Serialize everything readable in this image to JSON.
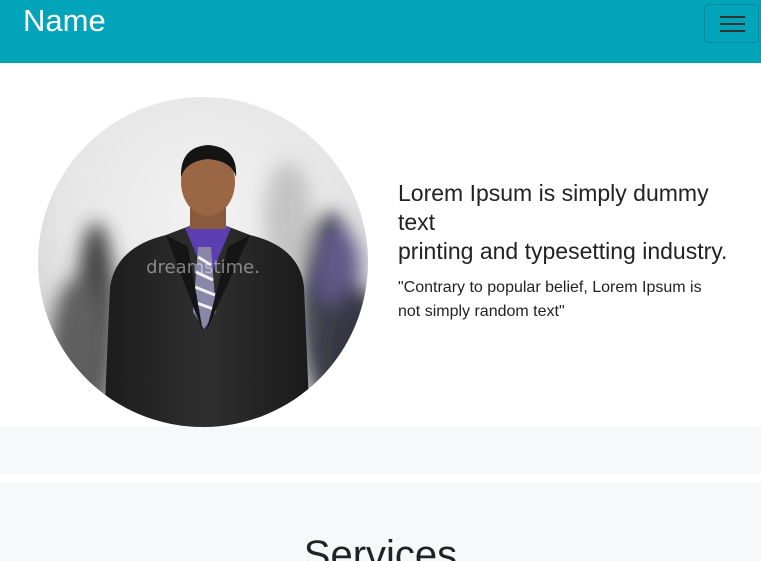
{
  "navbar": {
    "brand": "Name",
    "menu_icon": "hamburger-menu-icon",
    "bg_color": "#02a4b9"
  },
  "hero": {
    "photo": "profile-photo",
    "headline_line1": "Lorem Ipsum is simply dummy text",
    "headline_line2": "printing and typesetting industry.",
    "quote": "\"Contrary to popular belief, Lorem Ipsum is not simply random text\""
  },
  "services": {
    "title": "Services"
  }
}
